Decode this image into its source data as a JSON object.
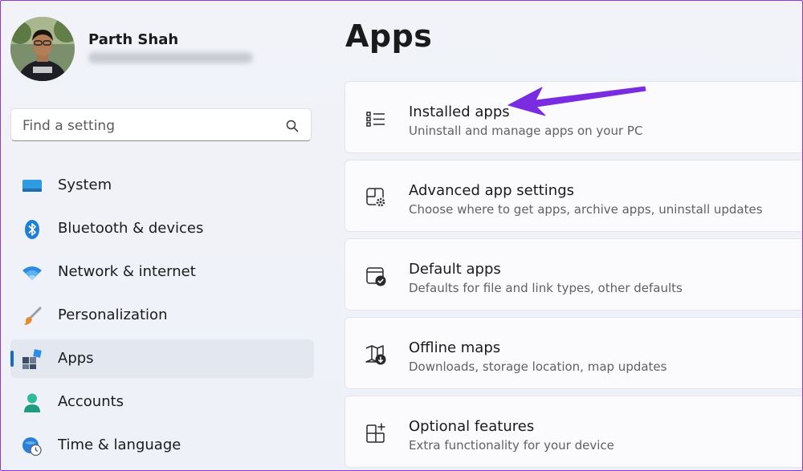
{
  "user": {
    "name": "Parth Shah"
  },
  "search": {
    "placeholder": "Find a setting",
    "icon": "search-icon"
  },
  "sidebar": {
    "items": [
      {
        "label": "System",
        "icon": "system-icon",
        "active": false
      },
      {
        "label": "Bluetooth & devices",
        "icon": "bluetooth-icon",
        "active": false
      },
      {
        "label": "Network & internet",
        "icon": "wifi-icon",
        "active": false
      },
      {
        "label": "Personalization",
        "icon": "brush-icon",
        "active": false
      },
      {
        "label": "Apps",
        "icon": "apps-icon",
        "active": true
      },
      {
        "label": "Accounts",
        "icon": "accounts-icon",
        "active": false
      },
      {
        "label": "Time & language",
        "icon": "time-language-icon",
        "active": false
      }
    ]
  },
  "main": {
    "title": "Apps",
    "cards": [
      {
        "title": "Installed apps",
        "description": "Uninstall and manage apps on your PC",
        "icon": "list-icon"
      },
      {
        "title": "Advanced app settings",
        "description": "Choose where to get apps, archive apps, uninstall updates",
        "icon": "app-settings-icon"
      },
      {
        "title": "Default apps",
        "description": "Defaults for file and link types, other defaults",
        "icon": "default-apps-icon"
      },
      {
        "title": "Offline maps",
        "description": "Downloads, storage location, map updates",
        "icon": "map-download-icon"
      },
      {
        "title": "Optional features",
        "description": "Extra functionality for your device",
        "icon": "optional-features-icon"
      }
    ]
  },
  "colors": {
    "accent": "#1a69c9",
    "annotation_arrow": "#7a2de0",
    "frame_border": "#8a3ad0"
  }
}
